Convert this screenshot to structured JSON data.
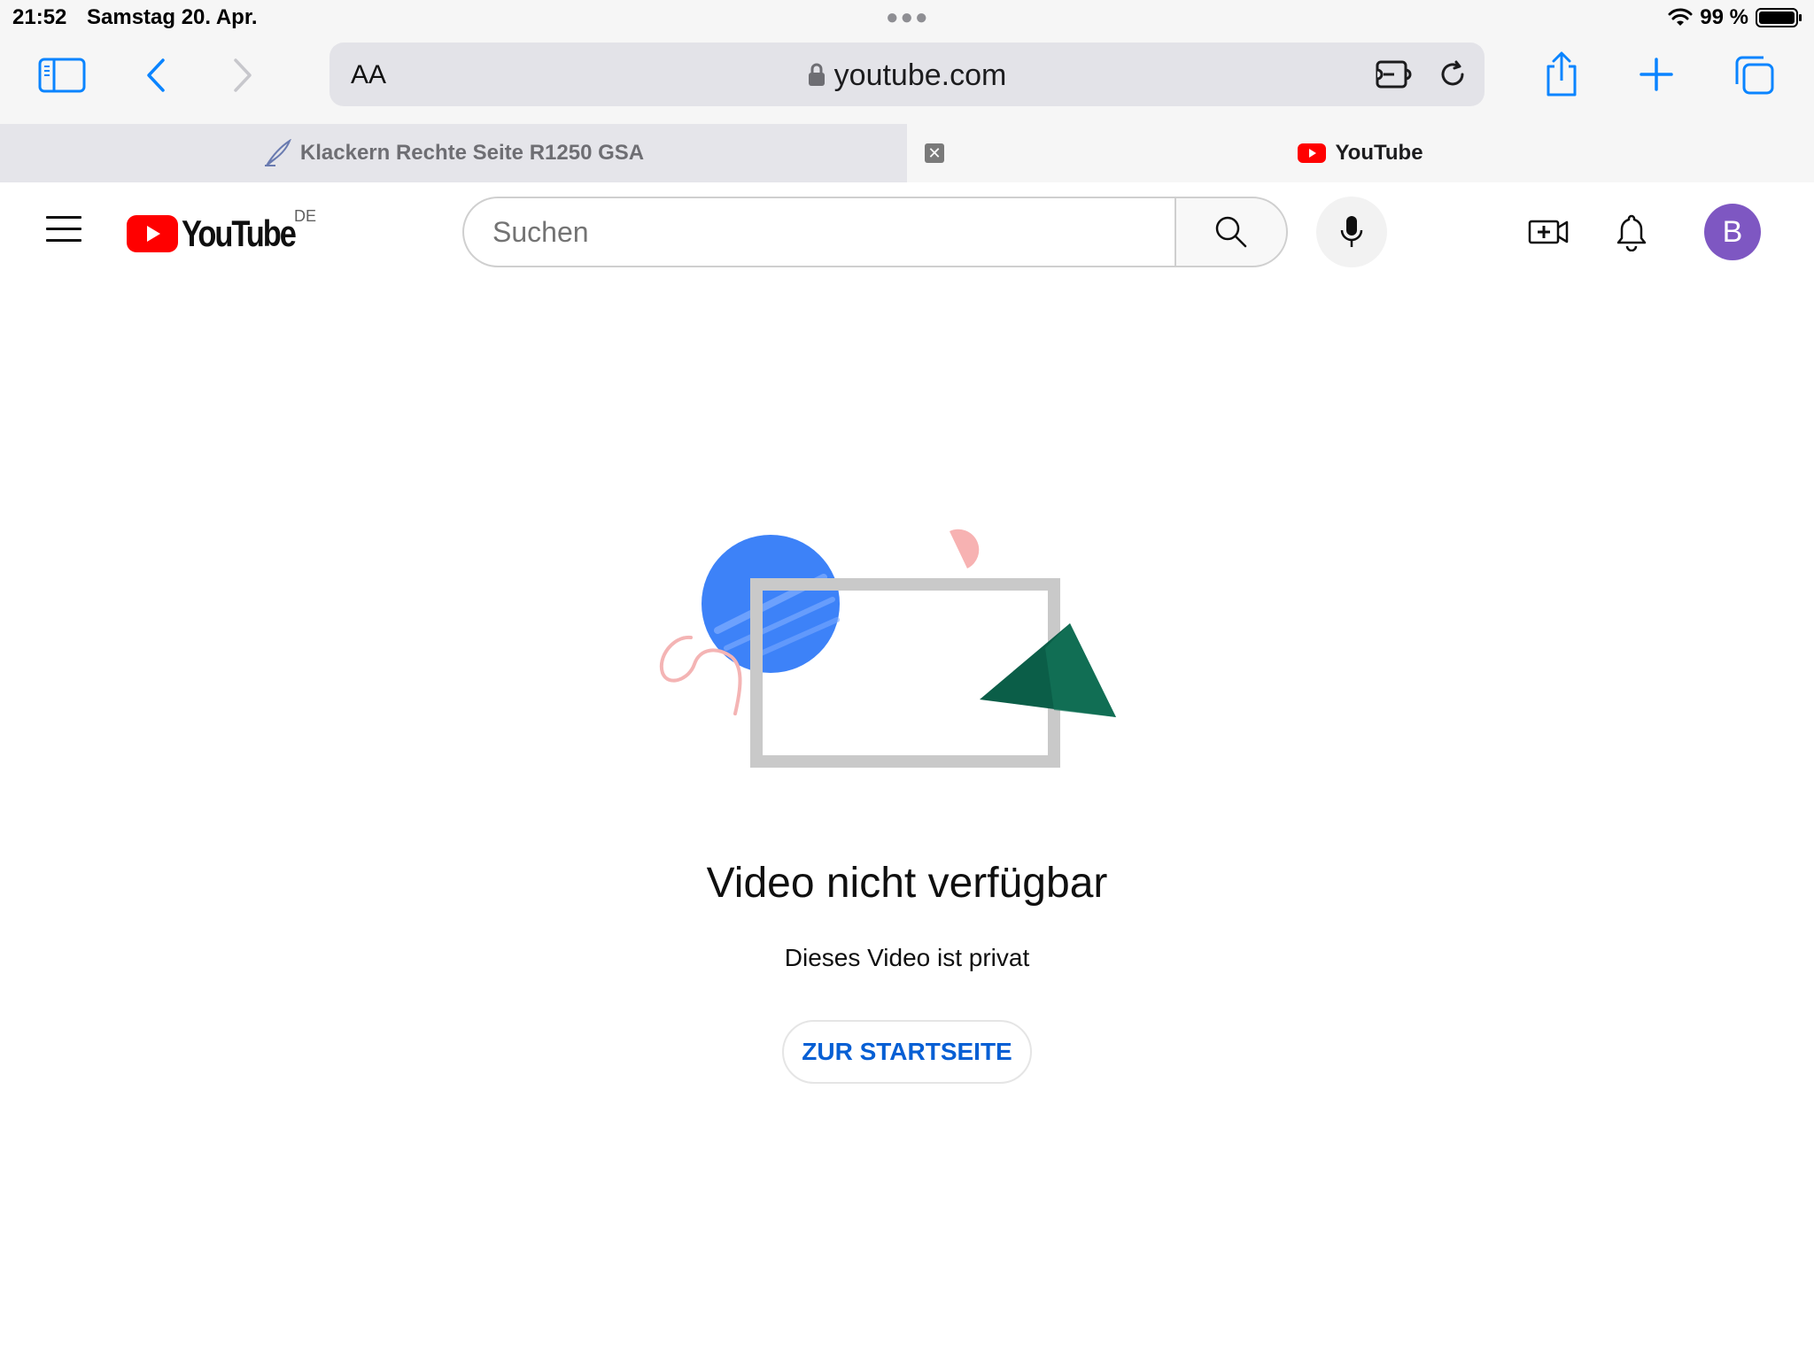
{
  "status_bar": {
    "time": "21:52",
    "date": "Samstag 20. Apr.",
    "battery": "99 %"
  },
  "toolbar": {
    "aa_label": "AA",
    "url": "youtube.com"
  },
  "tabs": [
    {
      "label": "Klackern Rechte Seite R1250 GSA",
      "active": false
    },
    {
      "label": "YouTube",
      "active": true
    }
  ],
  "yt_header": {
    "logo_text": "YouTube",
    "country": "DE",
    "search_placeholder": "Suchen",
    "avatar_letter": "B"
  },
  "main": {
    "title": "Video nicht verfügbar",
    "subtitle": "Dieses Video ist privat",
    "home_button": "ZUR STARTSEITE"
  },
  "colors": {
    "yt_red": "#ff0000",
    "link_blue": "#065fd4",
    "avatar_purple": "#7e57c2",
    "ios_blue": "#0a84ff"
  }
}
